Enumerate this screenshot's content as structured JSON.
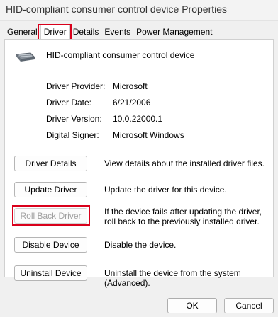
{
  "window": {
    "title": "HID-compliant consumer control device Properties"
  },
  "tabs": [
    {
      "label": "General"
    },
    {
      "label": "Driver"
    },
    {
      "label": "Details"
    },
    {
      "label": "Events"
    },
    {
      "label": "Power Management"
    }
  ],
  "device": {
    "name": "HID-compliant consumer control device",
    "icon": "keyboard-device-icon"
  },
  "driver_info": [
    {
      "label": "Driver Provider:",
      "value": "Microsoft"
    },
    {
      "label": "Driver Date:",
      "value": "6/21/2006"
    },
    {
      "label": "Driver Version:",
      "value": "10.0.22000.1"
    },
    {
      "label": "Digital Signer:",
      "value": "Microsoft Windows"
    }
  ],
  "actions": [
    {
      "button": "Driver Details",
      "desc": "View details about the installed driver files.",
      "enabled": true
    },
    {
      "button": "Update Driver",
      "desc": "Update the driver for this device.",
      "enabled": true
    },
    {
      "button": "Roll Back Driver",
      "desc": "If the device fails after updating the driver, roll back to the previously installed driver.",
      "enabled": false
    },
    {
      "button": "Disable Device",
      "desc": "Disable the device.",
      "enabled": true
    },
    {
      "button": "Uninstall Device",
      "desc": "Uninstall the device from the system (Advanced).",
      "enabled": true
    }
  ],
  "footer": {
    "ok": "OK",
    "cancel": "Cancel"
  },
  "colors": {
    "highlight": "#d9001b"
  }
}
